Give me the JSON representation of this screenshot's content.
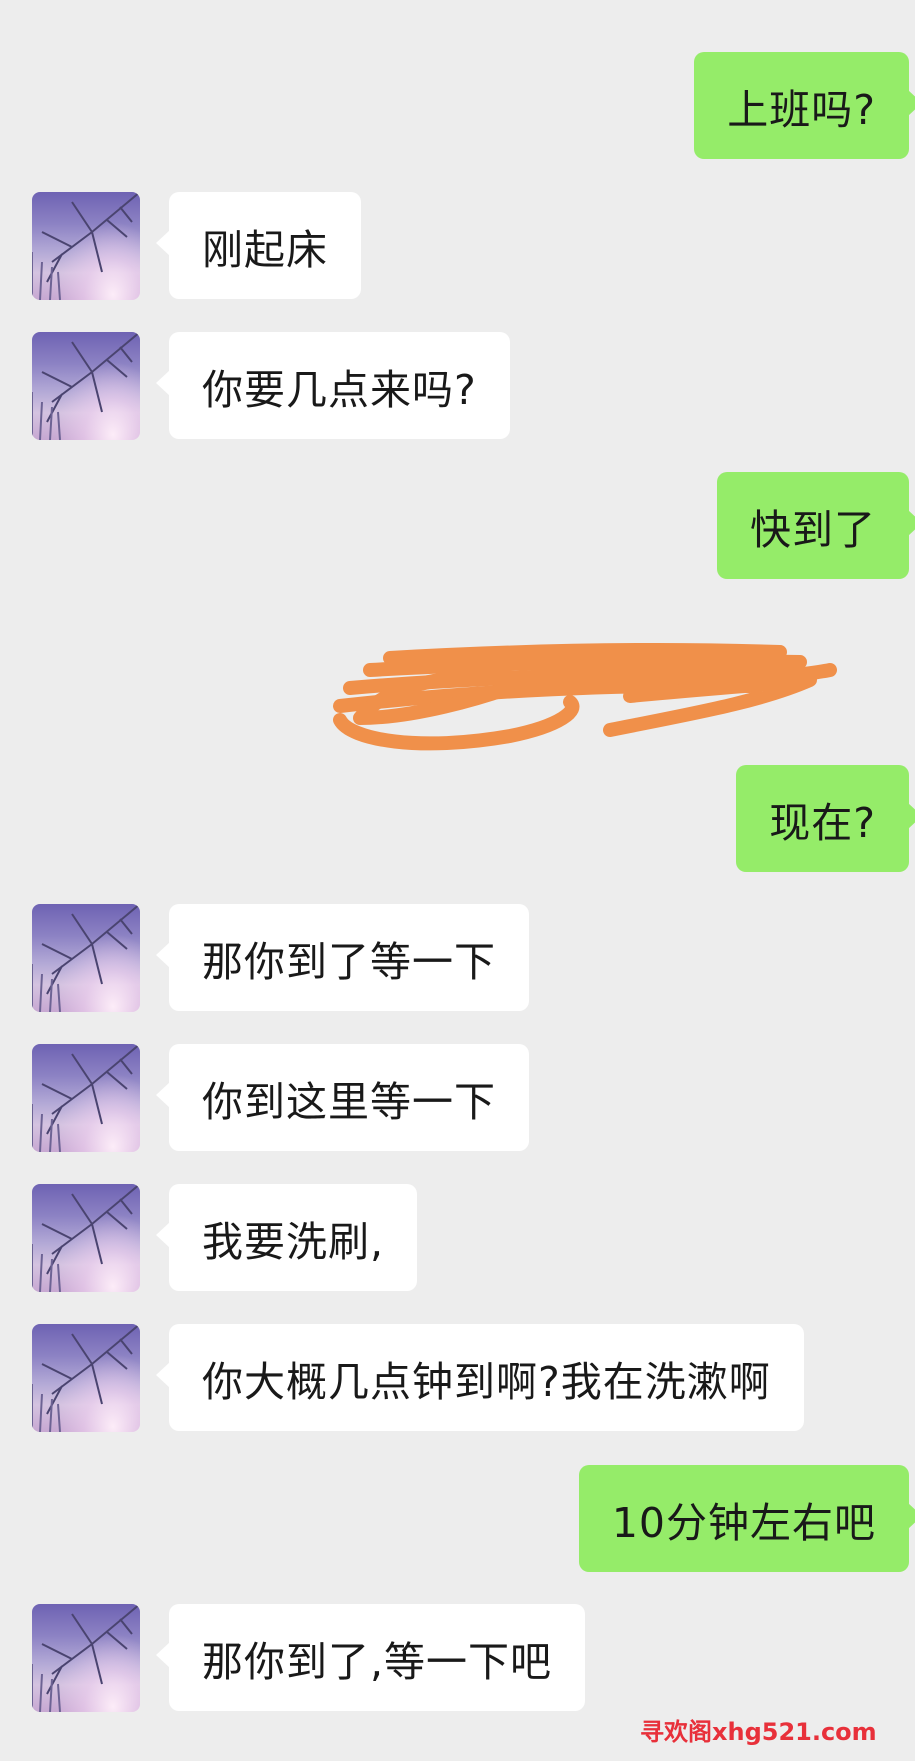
{
  "messages": [
    {
      "side": "out",
      "text": "上班吗?"
    },
    {
      "side": "in",
      "text": "刚起床"
    },
    {
      "side": "in",
      "text": "你要几点来吗?"
    },
    {
      "side": "out",
      "text": "快到了"
    },
    {
      "side": "out",
      "text": "现在?"
    },
    {
      "side": "in",
      "text": "那你到了等一下"
    },
    {
      "side": "in",
      "text": "你到这里等一下"
    },
    {
      "side": "in",
      "text": "我要洗刷,"
    },
    {
      "side": "in",
      "text": "你大概几点钟到啊?我在洗漱啊"
    },
    {
      "side": "out",
      "text": "10分钟左右吧"
    },
    {
      "side": "in",
      "text": "那你到了,等一下吧"
    }
  ],
  "redaction": {
    "color": "#f0904a"
  },
  "colors": {
    "background": "#ededed",
    "incoming": "#ffffff",
    "outgoing": "#95ec69"
  },
  "watermark": "寻欢阁xhg521.com"
}
